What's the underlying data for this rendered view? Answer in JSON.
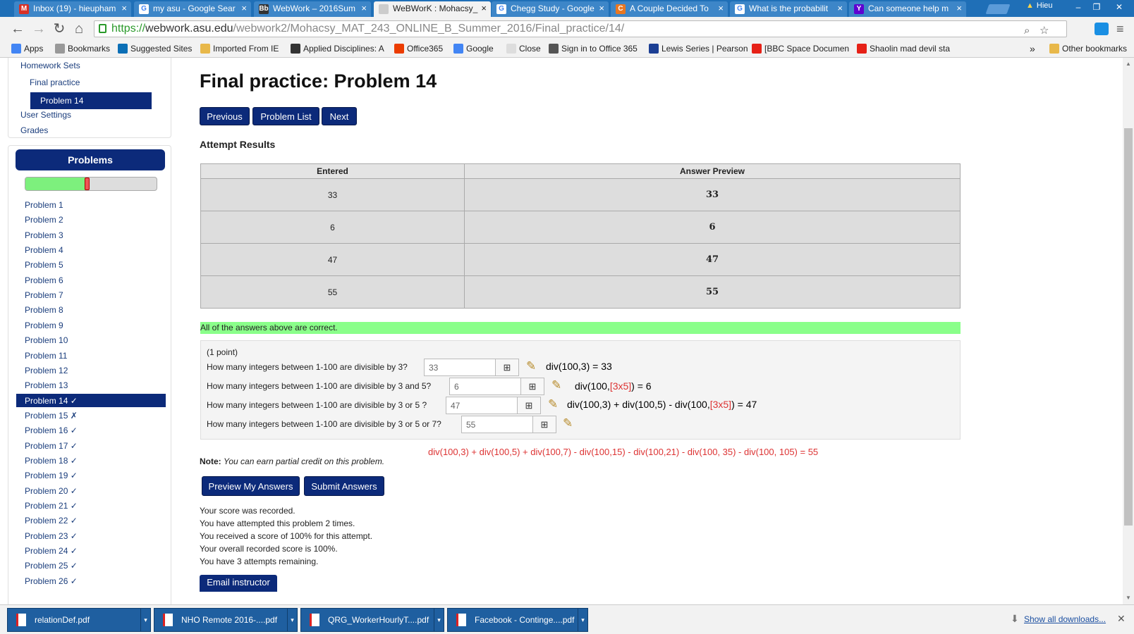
{
  "browser": {
    "tabs": [
      {
        "title": "Inbox (19) - hieupham",
        "icon": "gmail-icon",
        "color": "#d93025",
        "glyph": "M"
      },
      {
        "title": "my asu - Google Sear",
        "icon": "google-icon",
        "color": "#ffffff",
        "glyph": "G"
      },
      {
        "title": "WebWork – 2016Sum",
        "icon": "blackboard-icon",
        "color": "#333333",
        "glyph": "Bb"
      },
      {
        "title": "WeBWorK : Mohacsy_",
        "icon": "page-icon",
        "color": "#cccccc",
        "glyph": ""
      },
      {
        "title": "Chegg Study - Google",
        "icon": "google-icon",
        "color": "#ffffff",
        "glyph": "G"
      },
      {
        "title": "A Couple Decided To",
        "icon": "chegg-icon",
        "color": "#e87722",
        "glyph": "C"
      },
      {
        "title": "What is the probabilit",
        "icon": "google-icon",
        "color": "#ffffff",
        "glyph": "G"
      },
      {
        "title": "Can someone help m",
        "icon": "yahoo-icon",
        "color": "#5f01d1",
        "glyph": "Y"
      }
    ],
    "profile_name": "Hieu",
    "url": {
      "scheme": "https://",
      "host": "webwork.asu.edu",
      "path": "/webwork2/Mohacsy_MAT_243_ONLINE_B_Summer_2016/Final_practice/14/"
    },
    "bookmarks": [
      {
        "label": "Apps",
        "icon": "apps-icon",
        "color": "#4285f4"
      },
      {
        "label": "Bookmarks",
        "icon": "star-icon",
        "color": "#999999"
      },
      {
        "label": "Suggested Sites",
        "icon": "suggested-icon",
        "color": "#0b6fb6"
      },
      {
        "label": "Imported From IE",
        "icon": "folder-icon",
        "color": "#e8b84a"
      },
      {
        "label": "Applied Disciplines: A",
        "icon": "applied-icon",
        "color": "#333333"
      },
      {
        "label": "Office365",
        "icon": "office-icon",
        "color": "#eb3c00"
      },
      {
        "label": "Google",
        "icon": "google-icon",
        "color": "#4285f4"
      },
      {
        "label": "Close",
        "icon": "page-icon",
        "color": "#dddddd"
      },
      {
        "label": "Sign in to Office 365",
        "icon": "office-signin-icon",
        "color": "#555555"
      },
      {
        "label": "Lewis Series | Pearson",
        "icon": "pearson-icon",
        "color": "#1c3f94"
      },
      {
        "label": "[BBC Space Documen",
        "icon": "youtube-icon",
        "color": "#e62117"
      },
      {
        "label": "Shaolin mad devil sta",
        "icon": "youtube-icon",
        "color": "#e62117"
      }
    ],
    "bookmarks_overflow": "»",
    "other_bookmarks": "Other bookmarks"
  },
  "sidebar": {
    "homework_sets": "Homework Sets",
    "set_name": "Final practice",
    "current_problem": "Problem 14",
    "user_settings": "User Settings",
    "grades": "Grades",
    "problems_header": "Problems",
    "progress_fraction": 0.47,
    "problems": [
      "Problem 1",
      "Problem 2",
      "Problem 3",
      "Problem 4",
      "Problem 5",
      "Problem 6",
      "Problem 7",
      "Problem 8",
      "Problem 9",
      "Problem 10",
      "Problem 11",
      "Problem 12",
      "Problem 13",
      "Problem 14 ✓",
      "Problem 15 ✗",
      "Problem 16 ✓",
      "Problem 17 ✓",
      "Problem 18 ✓",
      "Problem 19 ✓",
      "Problem 20 ✓",
      "Problem 21 ✓",
      "Problem 22 ✓",
      "Problem 23 ✓",
      "Problem 24 ✓",
      "Problem 25 ✓",
      "Problem 26 ✓"
    ]
  },
  "main": {
    "title": "Final practice: Problem 14",
    "nav": {
      "previous": "Previous",
      "problem_list": "Problem List",
      "next": "Next"
    },
    "attempt_results_title": "Attempt Results",
    "results_headers": {
      "entered": "Entered",
      "preview": "Answer Preview"
    },
    "results": [
      {
        "entered": "33",
        "preview": "33"
      },
      {
        "entered": "6",
        "preview": "6"
      },
      {
        "entered": "47",
        "preview": "47"
      },
      {
        "entered": "55",
        "preview": "55"
      }
    ],
    "correct_message": "All of the answers above are correct.",
    "points": "(1 point)",
    "questions": [
      {
        "text": "How many integers between 1-100 are divisible by 3?",
        "value": "33"
      },
      {
        "text": "How many integers between 1-100 are divisible by 3 and 5?",
        "value": "6"
      },
      {
        "text": "How many integers between 1-100 are divisible by 3 or 5 ?",
        "value": "47"
      },
      {
        "text": "How many integers between 1-100 are divisible by 3 or 5 or 7?",
        "value": "55"
      }
    ],
    "handwritten": {
      "q1": "div(100,3) = 33",
      "q2_a": "div(100,",
      "q2_red": "[3x5]",
      "q2_b": ") = 6",
      "q3_a": "div(100,3) + div(100,5) - div(100,",
      "q3_red": "[3x5]",
      "q3_b": ") = 47",
      "q4": "div(100,3) + div(100,5) + div(100,7) - div(100,15) - div(100,21) - div(100, 35) - div(100, 105) =    55"
    },
    "note_label": "Note:",
    "note_text": "You can earn partial credit on this problem.",
    "actions": {
      "preview": "Preview My Answers",
      "submit": "Submit Answers"
    },
    "status": [
      "Your score was recorded.",
      "You have attempted this problem 2 times.",
      "You received a score of 100% for this attempt.",
      "Your overall recorded score is 100%.",
      "You have 3 attempts remaining."
    ],
    "email_instructor": "Email instructor"
  },
  "downloads": {
    "items": [
      "relationDef.pdf",
      "NHO Remote 2016-....pdf",
      "QRG_WorkerHourlyT....pdf",
      "Facebook - Continge....pdf"
    ],
    "show_all": "Show all downloads..."
  }
}
